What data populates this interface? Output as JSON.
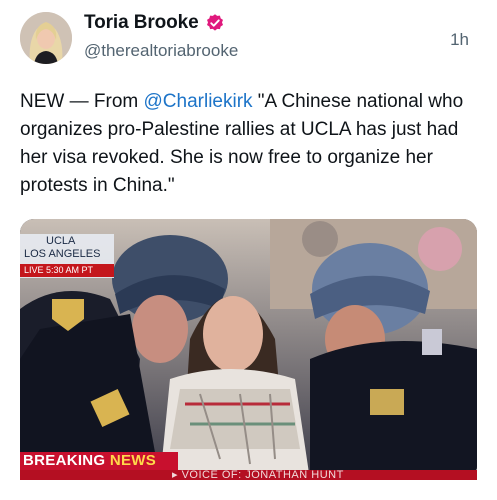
{
  "author": {
    "name": "Toria Brooke",
    "handle": "@therealtoriabrooke",
    "verified_icon": "verified-badge-icon",
    "verified_color": "#e0197d"
  },
  "time": "1h",
  "post": {
    "prefix": "NEW — From ",
    "mention": "@Charliekirk",
    "body": " \"A Chinese national who organizes pro-Palestine rallies at UCLA has just had her visa revoked. She is now free to organize her protests in China.\""
  },
  "media": {
    "location_line1": "UCLA",
    "location_line2": "LOS ANGELES",
    "location_time": "LIVE  5:30 AM PT",
    "breaking_part1": "BREAKING ",
    "breaking_part2": "NEWS",
    "ticker": "▸ VOICE OF: JONATHAN HUNT"
  },
  "colors": {
    "mention": "#1d74c8",
    "secondary_text": "#536471",
    "breaking_red": "#c8102e"
  }
}
